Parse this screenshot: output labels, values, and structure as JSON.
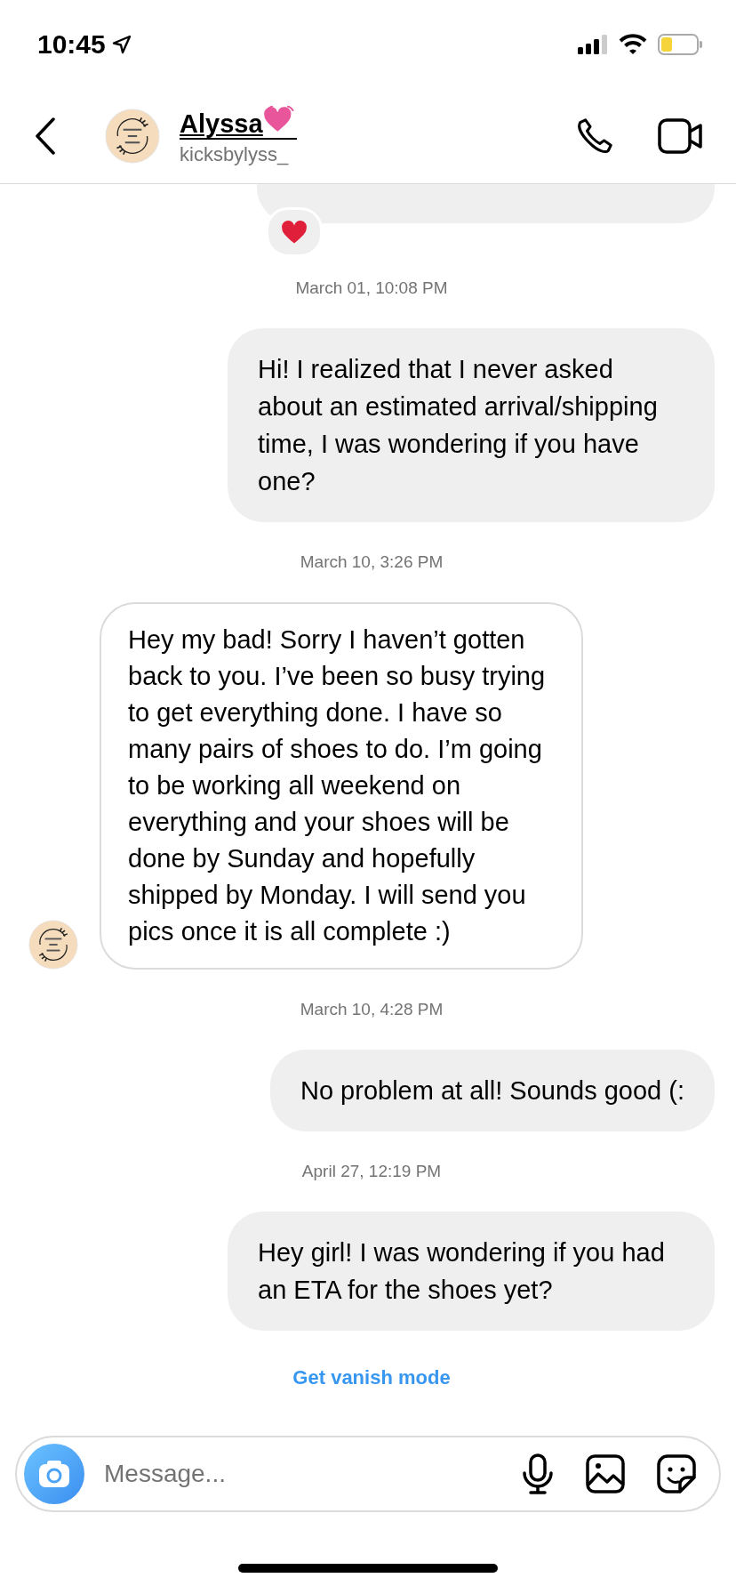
{
  "status_bar": {
    "time": "10:45"
  },
  "header": {
    "name": "Alyssa",
    "username": "kicksbylyss_"
  },
  "messages": [
    {
      "kind": "partial"
    },
    {
      "kind": "timestamp",
      "text": "March 01, 10:08 PM"
    },
    {
      "kind": "outgoing",
      "text": "Hi! I realized that I never asked about an estimated arrival/shipping time, I was wondering if you have one?"
    },
    {
      "kind": "timestamp",
      "text": "March 10, 3:26 PM"
    },
    {
      "kind": "incoming",
      "text": "Hey my bad! Sorry I haven’t gotten back to you. I’ve been so busy trying to get everything done. I have so many pairs of shoes to do. I’m going to be working all weekend on everything and your shoes will be done by Sunday and hopefully shipped by Monday. I will send you pics once it is all complete :)"
    },
    {
      "kind": "timestamp",
      "text": "March 10, 4:28 PM"
    },
    {
      "kind": "outgoing",
      "text": "No problem at all! Sounds good (:"
    },
    {
      "kind": "timestamp",
      "text": "April 27, 12:19 PM"
    },
    {
      "kind": "outgoing",
      "text": "Hey girl! I was wondering if you had an ETA for the shoes yet?"
    }
  ],
  "vanish_link": "Get vanish mode",
  "composer": {
    "placeholder": "Message..."
  }
}
